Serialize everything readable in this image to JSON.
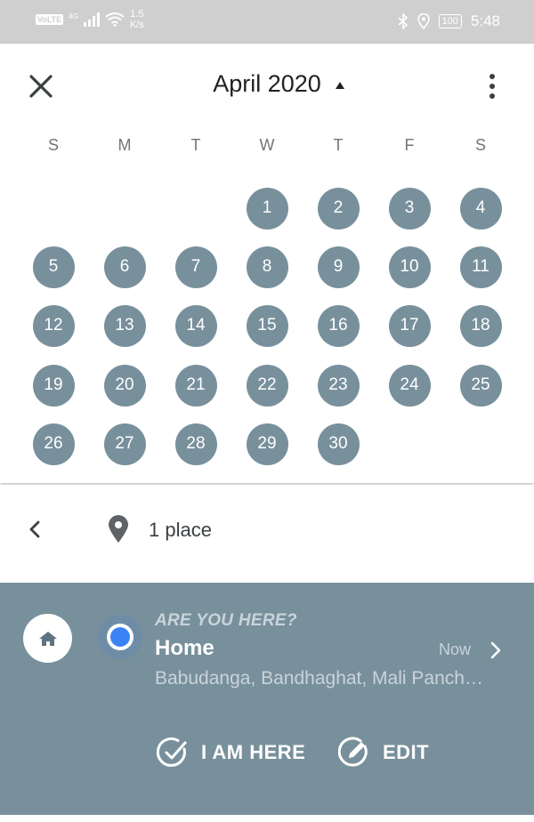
{
  "status_bar": {
    "volte_label": "VoLTE",
    "network_label": "4G",
    "speed_value": "1.5",
    "speed_unit": "K/s",
    "battery_level": "100",
    "time": "5:48"
  },
  "calendar": {
    "month_title": "April 2020",
    "weekdays": [
      "S",
      "M",
      "T",
      "W",
      "T",
      "F",
      "S"
    ],
    "first_weekday_index": 3,
    "days": [
      "1",
      "2",
      "3",
      "4",
      "5",
      "6",
      "7",
      "8",
      "9",
      "10",
      "11",
      "12",
      "13",
      "14",
      "15",
      "16",
      "17",
      "18",
      "19",
      "20",
      "21",
      "22",
      "23",
      "24",
      "25",
      "26",
      "27",
      "28",
      "29",
      "30"
    ],
    "day_color": "#78909c"
  },
  "place_bar": {
    "count_label": "1 place"
  },
  "visit_card": {
    "prompt": "ARE YOU HERE?",
    "place_name": "Home",
    "time_label": "Now",
    "address": "Babudanga, Bandhaghat, Mali Panch…",
    "confirm_label": "I AM HERE",
    "edit_label": "EDIT",
    "card_color": "#78909c",
    "radio_color": "#3b82f6"
  },
  "icons": {
    "close": "close-icon",
    "more": "more-vert-icon",
    "dropdown": "triangle-up-icon",
    "back": "chevron-left-icon",
    "pin": "location-pin-icon",
    "home": "home-icon",
    "chevron": "chevron-right-icon",
    "confirm": "check-circle-icon",
    "edit": "edit-circle-icon"
  }
}
